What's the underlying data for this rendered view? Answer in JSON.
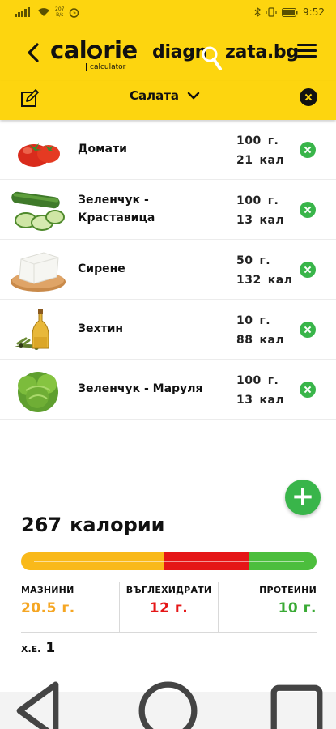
{
  "status_bar": {
    "speed": "207",
    "speed_unit": "B/s",
    "time": "9:52",
    "battery_icon": "battery-icon",
    "wifi_icon": "wifi-icon",
    "signal_icon": "signal-icon",
    "alarm_icon": "alarm-icon",
    "bluetooth_icon": "bluetooth-icon",
    "vibrate_icon": "vibrate-icon"
  },
  "header": {
    "logo_main_left": "ca",
    "logo_main_right": "rie",
    "logo_main_l": "l",
    "logo_sub": "calculator",
    "brand_left": "diagn",
    "brand_right": "zata.bg",
    "back_icon": "chevron-left-icon",
    "menu_icon": "hamburger-menu-icon"
  },
  "toolbar": {
    "meal_name": "Салата",
    "edit_icon": "edit-icon",
    "chevron_icon": "chevron-down-icon",
    "clear_icon": "close-icon"
  },
  "foods": [
    {
      "name": "Домати",
      "qty": "100",
      "unit": "г.",
      "kcal": "21",
      "kcal_unit": "кал",
      "image": "tomatoes"
    },
    {
      "name": "Зеленчук - Краставица",
      "qty": "100",
      "unit": "г.",
      "kcal": "13",
      "kcal_unit": "кал",
      "image": "cucumber"
    },
    {
      "name": "Сирене",
      "qty": "50",
      "unit": "г.",
      "kcal": "132",
      "kcal_unit": "кал",
      "image": "white-cheese"
    },
    {
      "name": "Зехтин",
      "qty": "10",
      "unit": "г.",
      "kcal": "88",
      "kcal_unit": "кал",
      "image": "olive-oil"
    },
    {
      "name": "Зеленчук - Маруля",
      "qty": "100",
      "unit": "г.",
      "kcal": "13",
      "kcal_unit": "кал",
      "image": "lettuce"
    }
  ],
  "add_button": {
    "label": "+"
  },
  "summary": {
    "total_value": "267",
    "total_label": "калории",
    "macro_bar": [
      {
        "name": "fat",
        "fraction": 0.485,
        "color": "#f9b91a"
      },
      {
        "name": "carbs",
        "fraction": 0.285,
        "color": "#e51617"
      },
      {
        "name": "protein",
        "fraction": 0.23,
        "color": "#4cbe3d"
      }
    ],
    "macros": [
      {
        "label": "МАЗНИНИ",
        "value": "20.5 г.",
        "color": "#f5a623"
      },
      {
        "label": "ВЪГЛЕХИДРАТИ",
        "value": "12 г.",
        "color": "#e51617"
      },
      {
        "label": "ПРОТЕИНИ",
        "value": "10 г.",
        "color": "#3aaa35"
      }
    ],
    "xe_label": "Х.Е.",
    "xe_value": "1"
  },
  "nav_bar": {
    "back_icon": "triangle-back-icon",
    "home_icon": "circle-home-icon",
    "recents_icon": "square-recents-icon"
  }
}
